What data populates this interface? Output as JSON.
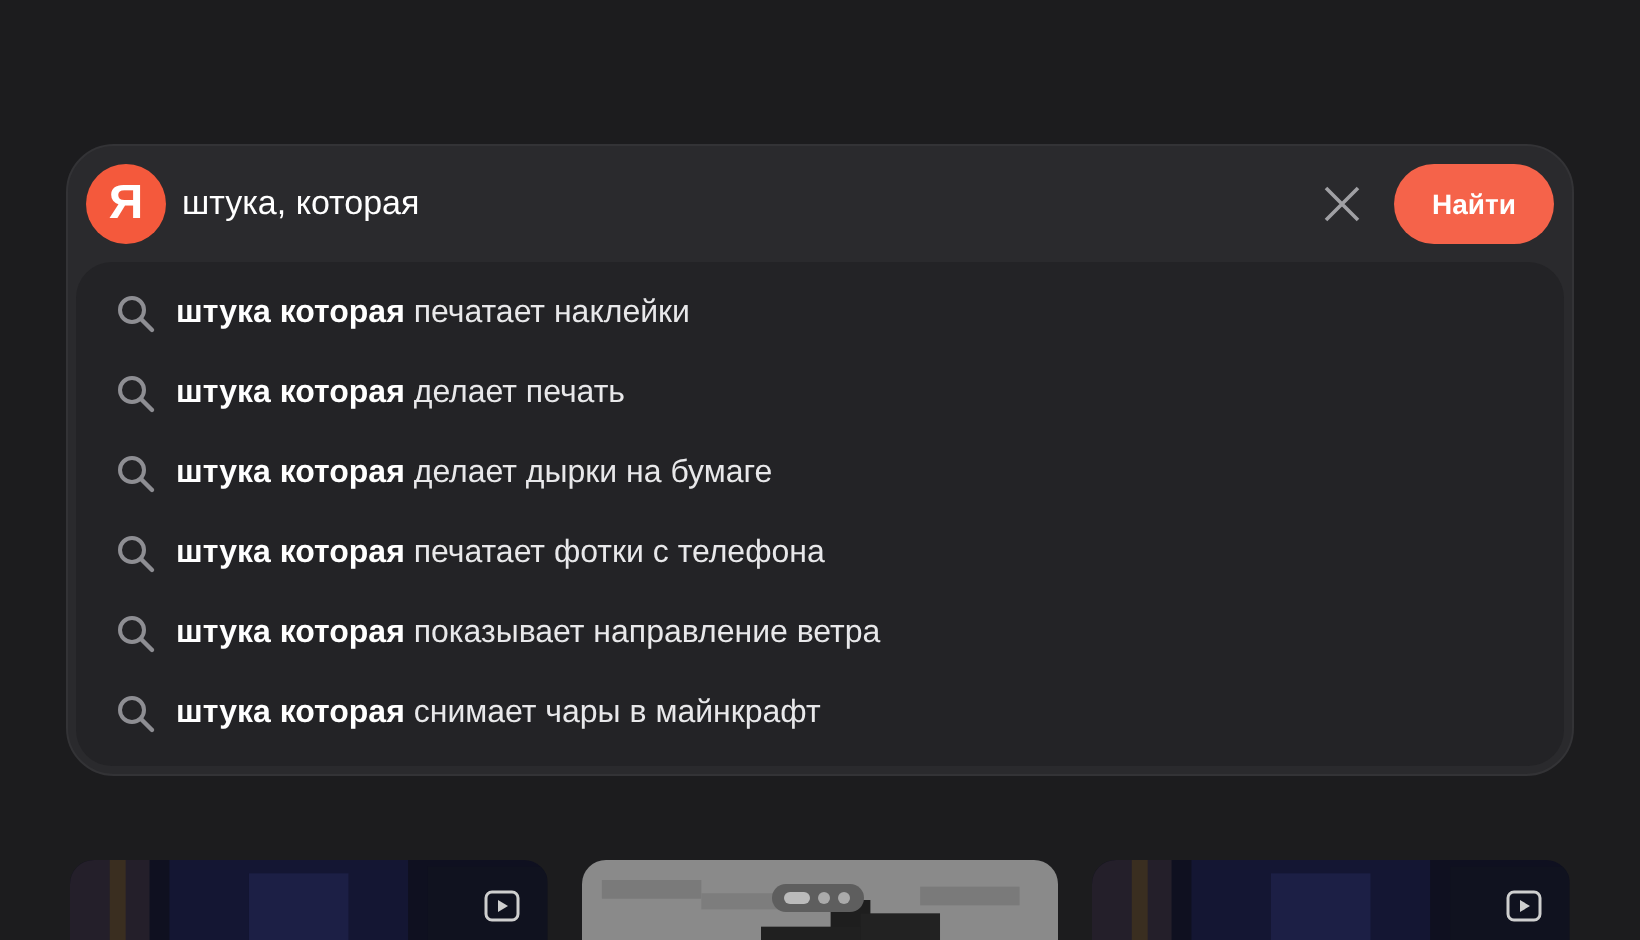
{
  "search": {
    "logo": "Я",
    "value": "штука, которая",
    "button": "Найти"
  },
  "suggestions": [
    {
      "text": "**штука которая** печатает наклейки"
    },
    {
      "text": "**штука которая** делает печать"
    },
    {
      "text": "**штука которая** делает дырки на бумаге"
    },
    {
      "text": "**штука которая** печатает фотки с телефона"
    },
    {
      "text": "**штука которая** показывает направление ветра"
    },
    {
      "text": "**штука которая** снимает чары в майнкрафт"
    }
  ],
  "cards": [
    {
      "kind": "video"
    },
    {
      "kind": "gallery"
    },
    {
      "kind": "video"
    }
  ]
}
